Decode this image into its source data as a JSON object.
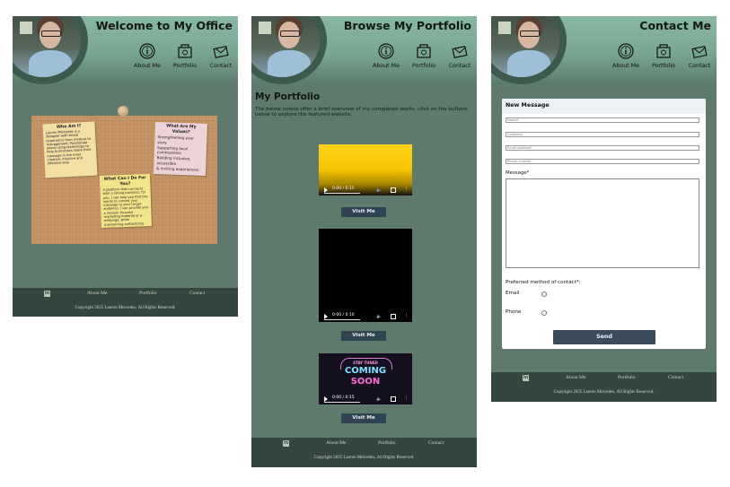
{
  "nav": {
    "about": "About Me",
    "portfolio": "Portfolio",
    "contact": "Contact"
  },
  "footer": {
    "about": "About Me",
    "portfolio": "Portfolio",
    "contact": "Contact",
    "copyright": "Copyright 2025 Lauren Mercedes, All Rights Reserved.",
    "linkedin_badge": "in"
  },
  "office": {
    "title": "Welcome to My Office",
    "note_who": {
      "title": "Who Am I?",
      "text": "Lauren Mercedes is a designer with broad experience from medical to management. Passionate about using technology to help businesses share their message in the most creative, intuitive and effective way."
    },
    "note_values": {
      "title": "What Are My Values?",
      "lines": [
        "Strengthening your story",
        "Supporting local communities",
        "Building inclusive, accessible",
        "& inviting experiences."
      ]
    },
    "note_do": {
      "title": "What Can I Do For You?",
      "text": "A platform that connects with a strong business, for you. I can help you find the words to convey your message to your target audience. I can provide you a mission focused marketing material or a webpage, while maintaining authenticity."
    }
  },
  "portfolio": {
    "title": "Browse My Portfolio",
    "heading": "My Portfolio",
    "intro": "The below videos offer a brief overview of my completed works, click on the buttons below to explore the featured website.",
    "videos": [
      {
        "time": "0:00 / 0:15",
        "button": "Visit Me"
      },
      {
        "time": "0:00 / 0:10",
        "button": "Visit Me"
      },
      {
        "time": "0:00 / 0:15",
        "button": "Visit Me",
        "overlay": [
          "STAY TUNED",
          "COMING",
          "SOON"
        ]
      }
    ]
  },
  "contact": {
    "title": "Contact Me",
    "form_title": "New Message",
    "name_placeholder": "Name*",
    "company_placeholder": "Company",
    "email_placeholder": "Email Address*",
    "phone_placeholder": "Phone number",
    "message_label": "Message*",
    "preferred_label": "Preferred method of contact*:",
    "option_email": "Email",
    "option_phone": "Phone",
    "send_label": "Send"
  },
  "colors": {
    "panel": "#5d7a6c",
    "header": "#8ab7a4",
    "footer": "#34473e",
    "button": "#2f4351"
  },
  "icons": [
    "info-icon",
    "portfolio-folder-icon",
    "mail-icon",
    "linkedin-icon",
    "play-icon",
    "volume-icon",
    "fullscreen-icon",
    "more-icon"
  ]
}
